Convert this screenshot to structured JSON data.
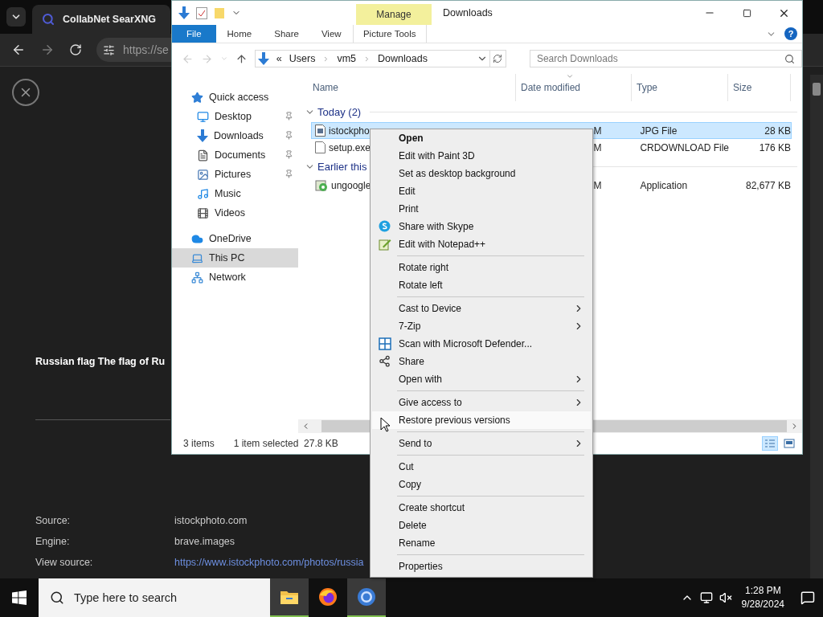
{
  "browser": {
    "tab": {
      "title": "CollabNet SearXNG"
    },
    "address": "https://se",
    "result": {
      "title": "Russian flag The flag of Ru",
      "details": [
        {
          "label": "Source:",
          "value": "istockphoto.com",
          "kind": "text"
        },
        {
          "label": "Engine:",
          "value": "brave.images",
          "kind": "text"
        },
        {
          "label": "View source:",
          "value": "https://www.istockphoto.com/photos/russia",
          "kind": "link"
        }
      ]
    }
  },
  "explorer": {
    "title": "Downloads",
    "contextual_tab": "Manage",
    "help": "?",
    "ribbon_tabs": [
      {
        "label": "File",
        "kind": "file"
      },
      {
        "label": "Home",
        "kind": "tab"
      },
      {
        "label": "Share",
        "kind": "tab"
      },
      {
        "label": "View",
        "kind": "tab"
      },
      {
        "label": "Picture Tools",
        "kind": "contextual"
      }
    ],
    "breadcrumb": [
      "«",
      "Users",
      "vm5",
      "Downloads"
    ],
    "search": {
      "placeholder": "Search Downloads"
    },
    "nav": [
      {
        "label": "Quick access",
        "selected": false,
        "pinned": false,
        "children": [
          {
            "label": "Desktop",
            "selected": false,
            "pinned": true
          },
          {
            "label": "Downloads",
            "selected": false,
            "pinned": true
          },
          {
            "label": "Documents",
            "selected": false,
            "pinned": true
          },
          {
            "label": "Pictures",
            "selected": false,
            "pinned": true
          },
          {
            "label": "Music",
            "selected": false,
            "pinned": false
          },
          {
            "label": "Videos",
            "selected": false,
            "pinned": false
          }
        ]
      },
      {
        "label": "OneDrive",
        "selected": false,
        "pinned": false
      },
      {
        "label": "This PC",
        "selected": true,
        "pinned": false
      },
      {
        "label": "Network",
        "selected": false,
        "pinned": false
      }
    ],
    "columns": [
      {
        "label": "Name",
        "sorted": false
      },
      {
        "label": "Date modified",
        "sorted": true
      },
      {
        "label": "Type",
        "sorted": false
      },
      {
        "label": "Size",
        "sorted": false
      }
    ],
    "groups": [
      {
        "label": "Today (2)",
        "rows": [
          {
            "name": "istockpho",
            "date": "M",
            "type": "JPG File",
            "size": "28 KB",
            "kind": "image",
            "selected": true
          },
          {
            "name": "setup.exe",
            "date": "M",
            "type": "CRDOWNLOAD File",
            "size": "176 KB",
            "kind": "file",
            "selected": false
          }
        ]
      },
      {
        "label": "Earlier this",
        "rows": [
          {
            "name": "ungoogle",
            "date": "M",
            "type": "Application",
            "size": "82,677 KB",
            "kind": "application",
            "selected": false
          }
        ]
      }
    ],
    "status": {
      "count": "3 items",
      "selection": "1 item selected  27.8 KB"
    }
  },
  "context_menu": [
    {
      "kind": "item",
      "label": "Open",
      "default": true,
      "submenu": false,
      "highlighted": false
    },
    {
      "kind": "item",
      "label": "Edit with Paint 3D",
      "default": false,
      "submenu": false,
      "highlighted": false
    },
    {
      "kind": "item",
      "label": "Set as desktop background",
      "default": false,
      "submenu": false,
      "highlighted": false
    },
    {
      "kind": "item",
      "label": "Edit",
      "default": false,
      "submenu": false,
      "highlighted": false
    },
    {
      "kind": "item",
      "label": "Print",
      "default": false,
      "submenu": false,
      "highlighted": false
    },
    {
      "kind": "item",
      "label": "Share with Skype",
      "default": false,
      "submenu": false,
      "highlighted": false
    },
    {
      "kind": "item",
      "label": "Edit with Notepad++",
      "default": false,
      "submenu": false,
      "highlighted": false
    },
    {
      "kind": "separator"
    },
    {
      "kind": "item",
      "label": "Rotate right",
      "default": false,
      "submenu": false,
      "highlighted": false
    },
    {
      "kind": "item",
      "label": "Rotate left",
      "default": false,
      "submenu": false,
      "highlighted": false
    },
    {
      "kind": "separator"
    },
    {
      "kind": "item",
      "label": "Cast to Device",
      "default": false,
      "submenu": true,
      "highlighted": false
    },
    {
      "kind": "item",
      "label": "7-Zip",
      "default": false,
      "submenu": true,
      "highlighted": false
    },
    {
      "kind": "item",
      "label": "Scan with Microsoft Defender...",
      "default": false,
      "submenu": false,
      "highlighted": false
    },
    {
      "kind": "item",
      "label": "Share",
      "default": false,
      "submenu": false,
      "highlighted": false
    },
    {
      "kind": "item",
      "label": "Open with",
      "default": false,
      "submenu": true,
      "highlighted": false
    },
    {
      "kind": "separator"
    },
    {
      "kind": "item",
      "label": "Give access to",
      "default": false,
      "submenu": true,
      "highlighted": false
    },
    {
      "kind": "item",
      "label": "Restore previous versions",
      "default": false,
      "submenu": false,
      "highlighted": true
    },
    {
      "kind": "separator"
    },
    {
      "kind": "item",
      "label": "Send to",
      "default": false,
      "submenu": true,
      "highlighted": false
    },
    {
      "kind": "separator"
    },
    {
      "kind": "item",
      "label": "Cut",
      "default": false,
      "submenu": false,
      "highlighted": false
    },
    {
      "kind": "item",
      "label": "Copy",
      "default": false,
      "submenu": false,
      "highlighted": false
    },
    {
      "kind": "separator"
    },
    {
      "kind": "item",
      "label": "Create shortcut",
      "default": false,
      "submenu": false,
      "highlighted": false
    },
    {
      "kind": "item",
      "label": "Delete",
      "default": false,
      "submenu": false,
      "highlighted": false
    },
    {
      "kind": "item",
      "label": "Rename",
      "default": false,
      "submenu": false,
      "highlighted": false
    },
    {
      "kind": "separator"
    },
    {
      "kind": "item",
      "label": "Properties",
      "default": false,
      "submenu": false,
      "highlighted": false
    }
  ],
  "taskbar": {
    "search": {
      "placeholder": "Type here to search"
    },
    "apps": [
      {
        "active": true
      },
      {
        "active": false
      },
      {
        "active": true
      }
    ],
    "time": "1:28 PM",
    "date": "9/28/2024"
  }
}
